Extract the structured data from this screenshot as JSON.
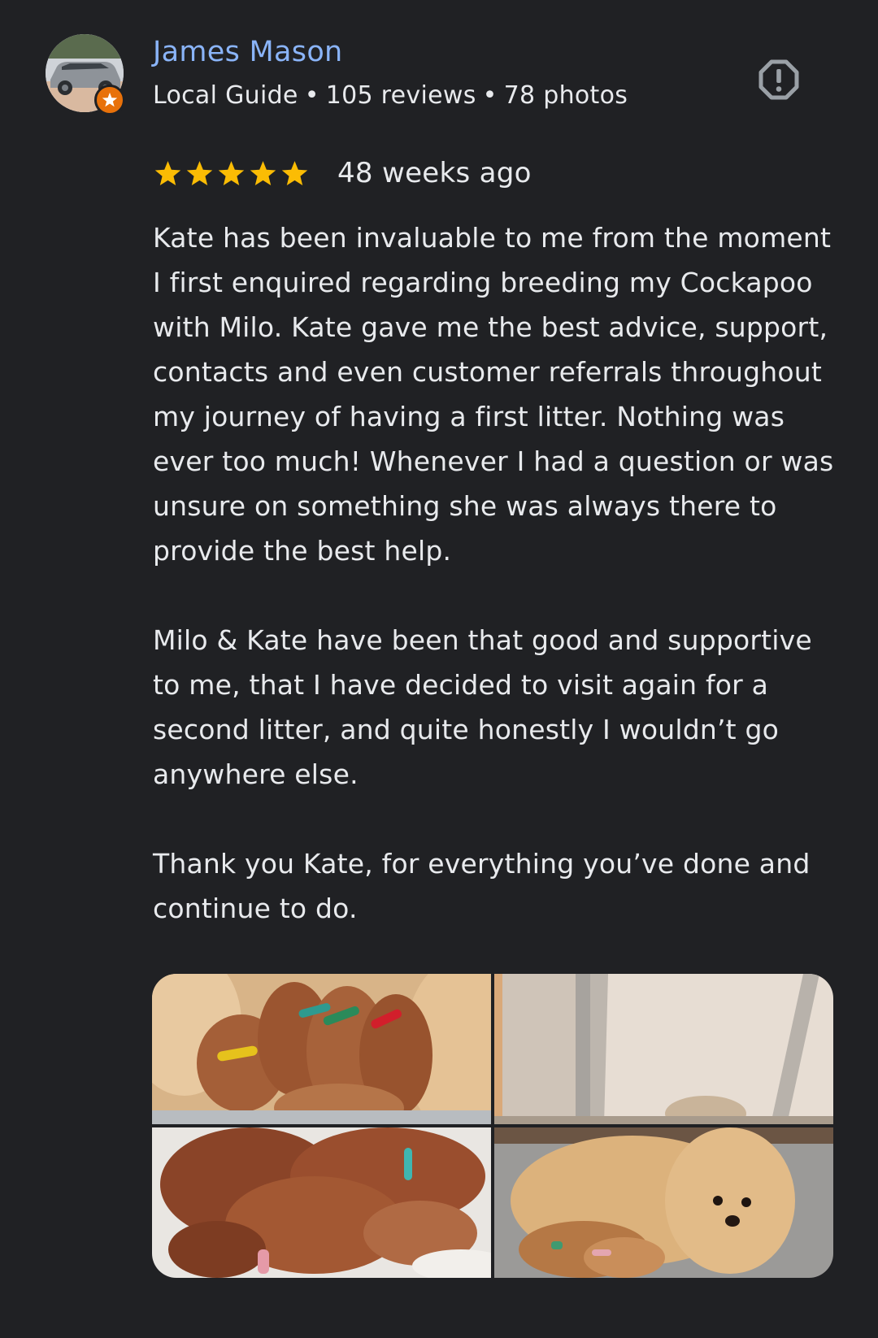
{
  "reviewer": {
    "name": "James Mason",
    "badge": "Local Guide",
    "reviews": "105 reviews",
    "photos": "78 photos",
    "separator": "•"
  },
  "review": {
    "rating": 5,
    "age": "48 weeks ago",
    "paragraphs": [
      "Kate has been invaluable to me from the moment I first enquired regarding breeding my Cockapoo with Milo. Kate gave me the best advice, support, contacts and even customer referrals throughout my journey of having a first litter. Nothing was ever too much! Whenever I had a question or was unsure on something she was always there to provide the best help.",
      "Milo & Kate have been that good and supportive to me, that I have decided to visit again for a second litter, and quite honestly I wouldn’t go anywhere else.",
      "Thank you Kate, for everything you’ve done and continue to do."
    ]
  },
  "photos": [
    {
      "name": "review-photo-puppies-collars"
    },
    {
      "name": "review-photo-room-corner"
    },
    {
      "name": "review-photo-sleeping-puppies"
    },
    {
      "name": "review-photo-mother-dog"
    }
  ],
  "colors": {
    "background": "#202124",
    "name": "#8ab4f8",
    "text": "#e8eaed",
    "star": "#fbbc04",
    "badge": "#e8710a",
    "icon": "#9aa0a6"
  },
  "icons": {
    "report": "report-icon",
    "star": "star-icon",
    "guide_badge": "local-guide-badge-icon"
  }
}
